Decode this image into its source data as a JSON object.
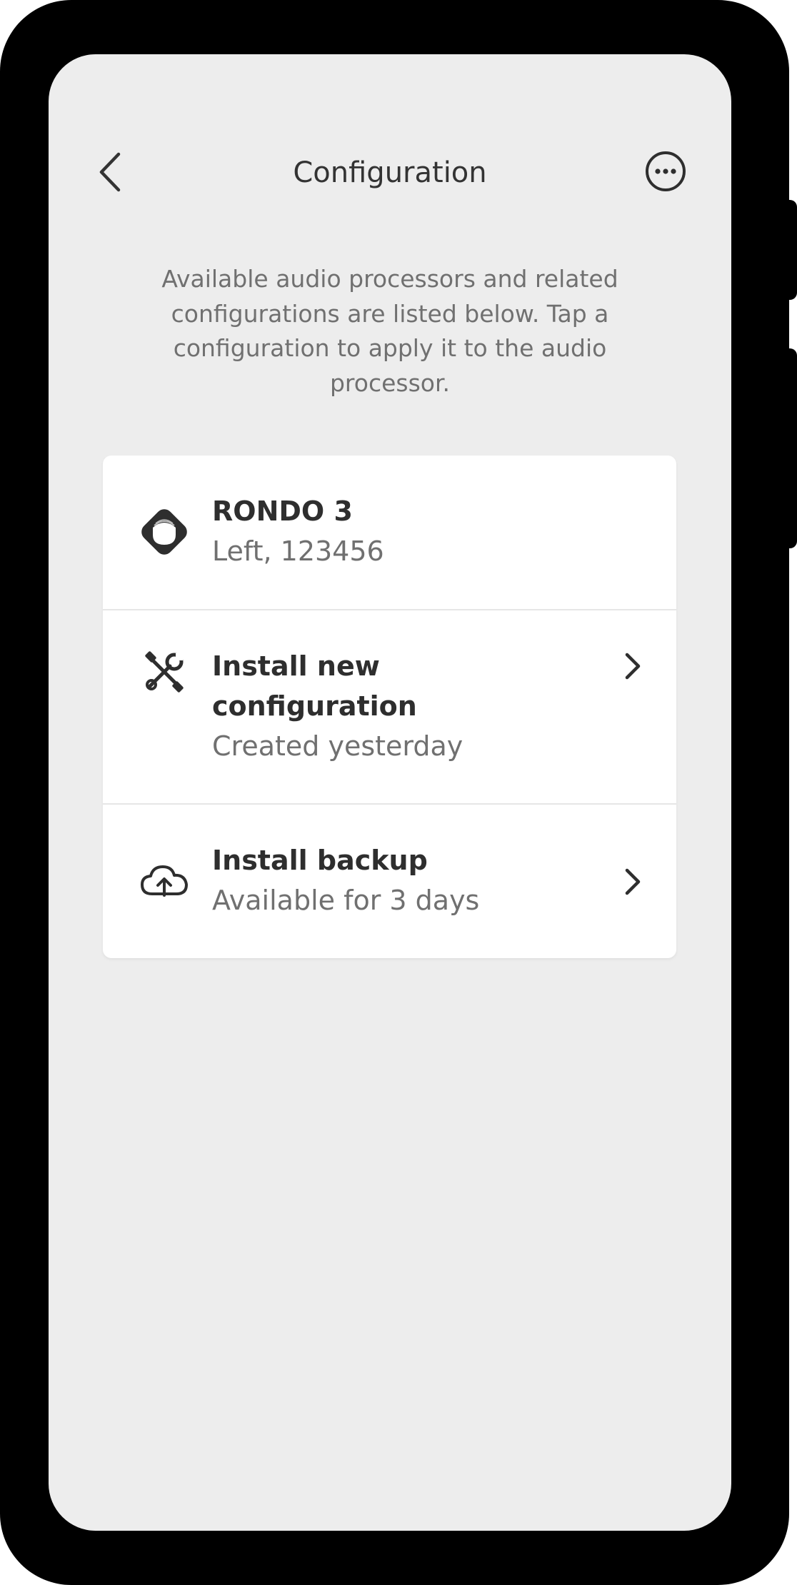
{
  "header": {
    "title": "Configuration",
    "back_icon": "chevron-left-icon",
    "more_icon": "more-options-icon"
  },
  "intro": {
    "text": "Available audio processors and related configurations are listed below. Tap a configuration to apply it to the audio processor."
  },
  "card": {
    "device": {
      "icon": "audio-processor-icon",
      "name": "RONDO 3",
      "detail": "Left, 123456"
    },
    "items": [
      {
        "icon": "tools-icon",
        "title": "Install new configuration",
        "subtitle": "Created yesterday"
      },
      {
        "icon": "cloud-upload-icon",
        "title": "Install backup",
        "subtitle": "Available for 3 days"
      }
    ]
  },
  "colors": {
    "screen_background": "#ededed",
    "card_background": "#ffffff",
    "text_primary": "#2e2e2e",
    "text_secondary": "#707070"
  }
}
